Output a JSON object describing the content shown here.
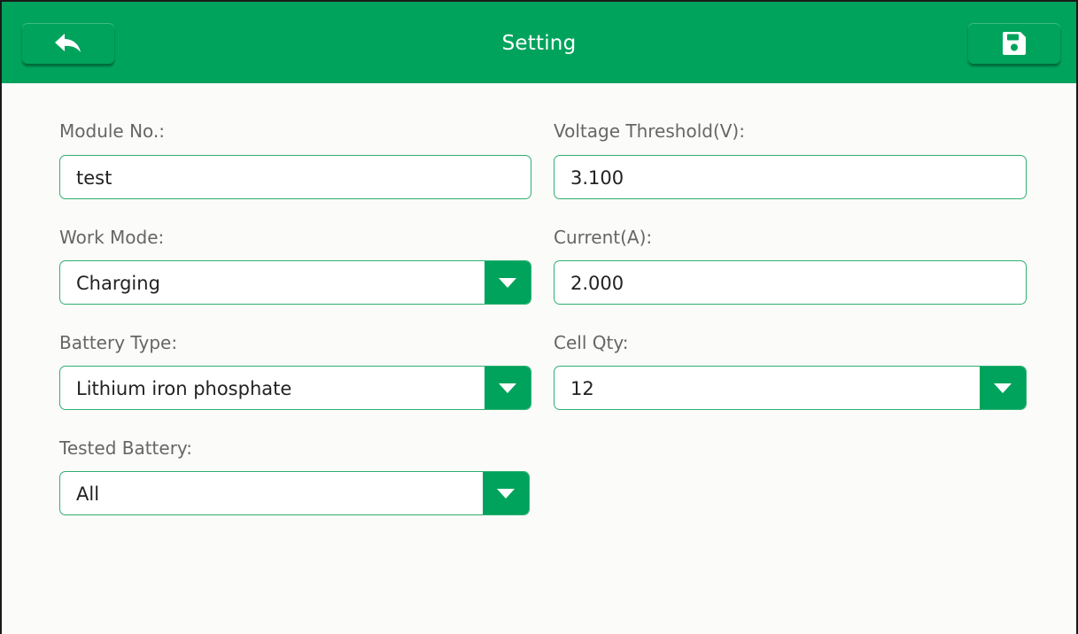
{
  "header": {
    "title": "Setting",
    "back_icon": "back-arrow-icon",
    "save_icon": "floppy-disk-icon"
  },
  "form": {
    "module_no": {
      "label": "Module No.:",
      "value": "test"
    },
    "voltage_threshold": {
      "label": "Voltage Threshold(V):",
      "value": "3.100"
    },
    "work_mode": {
      "label": "Work Mode:",
      "value": "Charging"
    },
    "current": {
      "label": "Current(A):",
      "value": "2.000"
    },
    "battery_type": {
      "label": "Battery Type:",
      "value": "Lithium iron phosphate"
    },
    "cell_qty": {
      "label": "Cell Qty:",
      "value": "12"
    },
    "tested_battery": {
      "label": "Tested Battery:",
      "value": "All"
    }
  },
  "colors": {
    "accent": "#00a35c",
    "border": "#2fb070",
    "label": "#666666",
    "background": "#fbfbfa"
  }
}
